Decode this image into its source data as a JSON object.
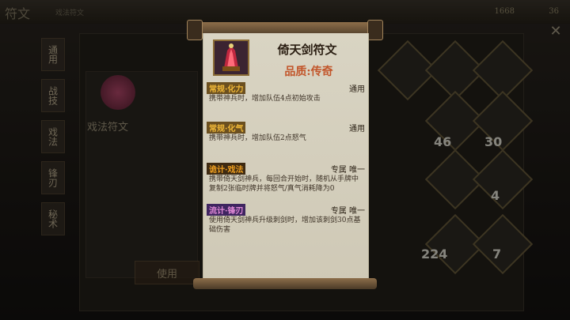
{
  "background": {
    "title": "符文",
    "subtitle": "戏法符文",
    "currency": "1668",
    "count": "36",
    "left_label": "戏法符文",
    "use_label": "使用",
    "tabs": [
      "通用",
      "战技",
      "戏法",
      "锋刃",
      "秘术"
    ],
    "grid_numbers": [
      "46",
      "30",
      "4",
      "224",
      "7"
    ]
  },
  "tooltip": {
    "item_name": "倚天剑符文",
    "quality_label": "品质:传奇",
    "sections": [
      {
        "tag": "常规·化力",
        "scope": "通用",
        "text": "携带神兵时，增加队伍4点初始攻击",
        "type": "normal"
      },
      {
        "tag": "常规·化气",
        "scope": "通用",
        "text": "携带神兵时，增加队伍2点怒气",
        "type": "normal"
      },
      {
        "tag": "诡计·戏法",
        "scope": "专属 唯一",
        "text": "携带倚天剑神兵，每回合开始时，随机从手牌中复制2张临时牌并将怒气/真气消耗降为0",
        "type": "trick"
      },
      {
        "tag": "流计·锋刃",
        "scope": "专属 唯一",
        "text": "使用倚天剑神兵升级刺剑时，增加该刺剑30点基础伤害",
        "type": "art"
      }
    ]
  },
  "colors": {
    "paper": "#d9d4c3",
    "quality": "#c2552a",
    "normal_tag": "#f0b838",
    "art_tag": "#e28bd8"
  },
  "icons": {
    "close": "close-icon",
    "item": "crystal-rune-icon"
  }
}
